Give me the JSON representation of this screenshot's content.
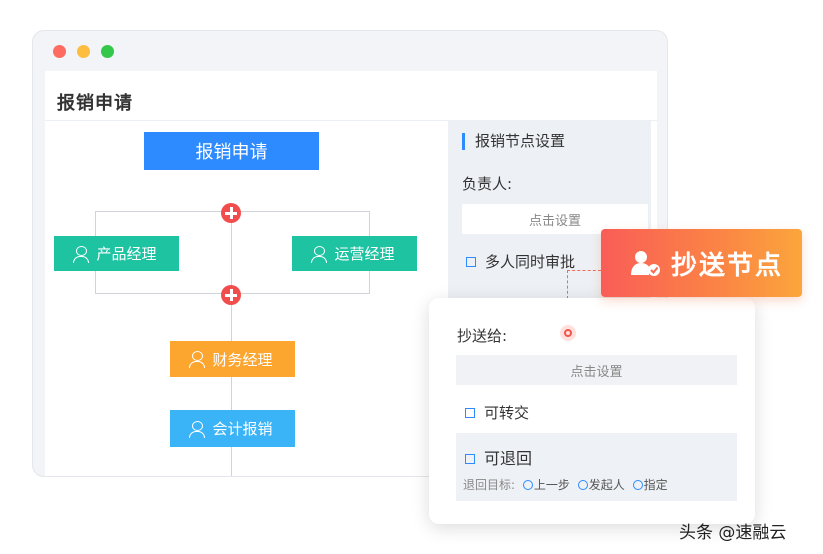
{
  "window": {
    "dot_colors": [
      "#fe6b61",
      "#fdbd3f",
      "#34c84a"
    ],
    "title": "报销申请"
  },
  "flow": {
    "start_node": "报销申请",
    "branch_nodes": [
      "产品经理",
      "运营经理"
    ],
    "finance_node": "财务经理",
    "accounting_node": "会计报销",
    "colors": {
      "start": "#2e8bff",
      "branch": "#1ec3a2",
      "finance": "#fca52f",
      "accounting": "#3ab3f7",
      "add": "#f24d4d"
    }
  },
  "settings": {
    "title": "报销节点设置",
    "owner_label": "负责人:",
    "set_button": "点击设置",
    "multi_approve": "多人同时审批"
  },
  "badge": {
    "label": "抄送节点",
    "icon": "user-check-icon"
  },
  "popup": {
    "cc_label": "抄送给:",
    "set_button": "点击设置",
    "transfer": "可转交",
    "return": "可退回",
    "return_target_label": "退回目标:",
    "return_options": [
      "上一步",
      "发起人",
      "指定"
    ]
  },
  "watermark": "头条 @速融云"
}
